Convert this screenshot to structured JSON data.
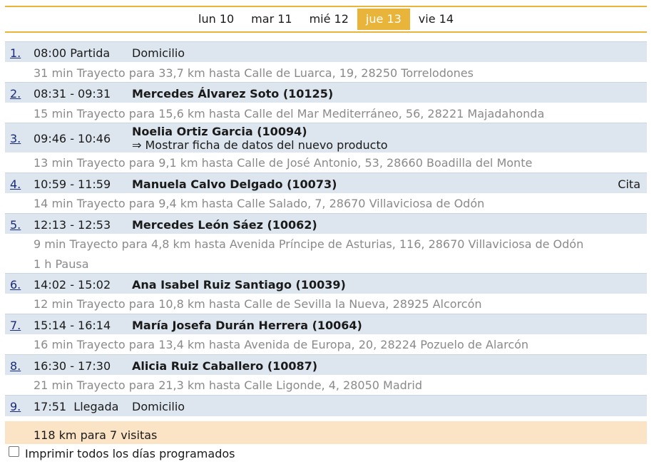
{
  "days": [
    {
      "label": "lun 10",
      "active": false
    },
    {
      "label": "mar 11",
      "active": false
    },
    {
      "label": "mié 12",
      "active": false
    },
    {
      "label": "jue 13",
      "active": true
    },
    {
      "label": "vie 14",
      "active": false
    }
  ],
  "stops": [
    {
      "num": "1.",
      "time": "08:00 Partida",
      "name": "Domicilio"
    },
    {
      "num": "2.",
      "time": "08:31 - 09:31",
      "name": "Mercedes Álvarez Soto (10125)"
    },
    {
      "num": "3.",
      "time": "09:46 - 10:46",
      "name": "Noelia Ortiz Garcia (10094)",
      "detail": "⇒ Mostrar ficha de datos del nuevo producto"
    },
    {
      "num": "4.",
      "time": "10:59 - 11:59",
      "name": "Manuela Calvo Delgado (10073)",
      "cita": "Cita"
    },
    {
      "num": "5.",
      "time": "12:13 - 12:53",
      "name": "Mercedes León Sáez (10062)"
    },
    {
      "num": "6.",
      "time": "14:02 - 15:02",
      "name": "Ana Isabel Ruiz Santiago (10039)"
    },
    {
      "num": "7.",
      "time": "15:14 - 16:14",
      "name": "María Josefa Durán Herrera (10064)"
    },
    {
      "num": "8.",
      "time": "16:30 - 17:30",
      "name": "Alicia Ruiz Caballero (10087)"
    },
    {
      "num": "9.",
      "time": "17:51  Llegada",
      "name": "Domicilio"
    }
  ],
  "travels": [
    "31 min Trayecto para 33,7 km hasta Calle de Luarca, 19, 28250 Torrelodones",
    "15 min Trayecto para 15,6 km hasta Calle del Mar Mediterráneo, 56, 28221 Majadahonda",
    "13 min Trayecto para 9,1 km hasta Calle de José Antonio, 53, 28660 Boadilla del Monte",
    "14 min Trayecto para 9,4 km hasta Calle Salado, 7, 28670 Villaviciosa de Odón",
    "9 min Trayecto para 4,8 km hasta Avenida Príncipe de Asturias, 116, 28670 Villaviciosa de Odón",
    "1 h Pausa",
    "12 min Trayecto para 10,8 km hasta Calle de Sevilla la Nueva, 28925 Alcorcón",
    "16 min Trayecto para 13,4 km hasta Avenida de Europa, 20, 28224 Pozuelo de Alarcón",
    "21 min Trayecto para 21,3 km hasta Calle Ligonde, 4, 28050 Madrid"
  ],
  "summary": "118 km para 7 visitas",
  "print_label": "Imprimir todos los días programados"
}
